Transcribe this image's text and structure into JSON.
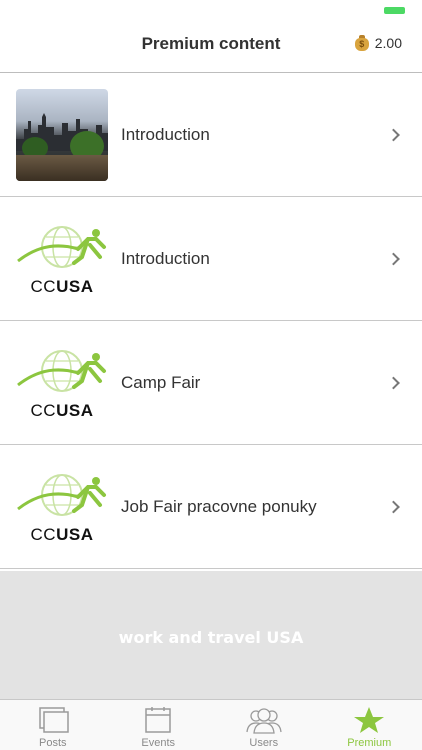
{
  "status_bar": {
    "battery_color": "#4cd964"
  },
  "header": {
    "title": "Premium content",
    "balance_value": "2.00",
    "balance_icon": "moneybag-icon"
  },
  "items": [
    {
      "label": "Introduction",
      "thumbnail": "photo"
    },
    {
      "label": "Introduction",
      "thumbnail": "ccusa-logo"
    },
    {
      "label": "Camp Fair",
      "thumbnail": "ccusa-logo"
    },
    {
      "label": "Job Fair pracovne ponuky",
      "thumbnail": "ccusa-logo"
    }
  ],
  "logo": {
    "prefix": "CC",
    "suffix": "USA",
    "green": "#8cc63f"
  },
  "banner": {
    "text": "work and travel USA",
    "bg": "#e3e3e3"
  },
  "tabs": [
    {
      "label": "Posts",
      "icon": "posts-icon",
      "active": false
    },
    {
      "label": "Events",
      "icon": "calendar-icon",
      "active": false
    },
    {
      "label": "Users",
      "icon": "users-icon",
      "active": false
    },
    {
      "label": "Premium",
      "icon": "star-icon",
      "active": true
    }
  ],
  "colors": {
    "accent": "#8cc63f",
    "inactive": "#8a8a8a"
  }
}
